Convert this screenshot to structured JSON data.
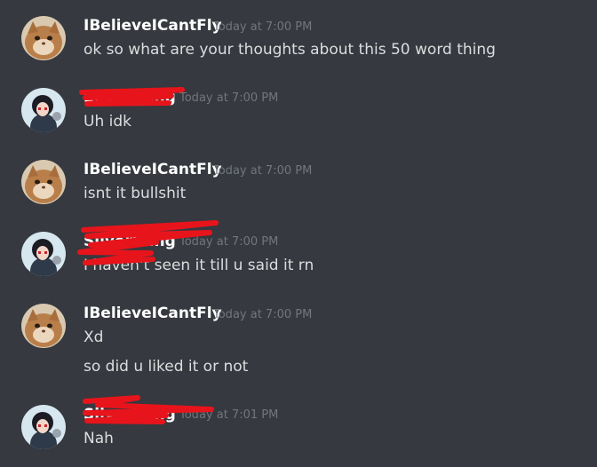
{
  "messages": [
    {
      "username": "IBelieveICantFly",
      "timestamp": "Today at 7:00 PM",
      "lines": [
        "ok so what are your thoughts about this 50 word thing"
      ]
    },
    {
      "username": "SilverWing",
      "timestamp": "Today at 7:00 PM",
      "lines": [
        "Uh idk"
      ]
    },
    {
      "username": "IBelieveICantFly",
      "timestamp": "Today at 7:00 PM",
      "lines": [
        "isnt it bullshit"
      ]
    },
    {
      "username": "SilverWing",
      "timestamp": "Today at 7:00 PM",
      "lines": [
        "I haven't seen it till u said it rn"
      ]
    },
    {
      "username": "IBelieveICantFly",
      "timestamp": "Today at 7:00 PM",
      "lines": [
        "Xd",
        "so did u liked it or not"
      ]
    },
    {
      "username": "SilverWing",
      "timestamp": "Today at 7:01 PM",
      "lines": [
        "Nah"
      ]
    }
  ],
  "colors": {
    "background": "#36393f",
    "username": "#ffffff",
    "timestamp": "#72767d",
    "text": "#dcddde",
    "redaction": "#e8141b"
  }
}
